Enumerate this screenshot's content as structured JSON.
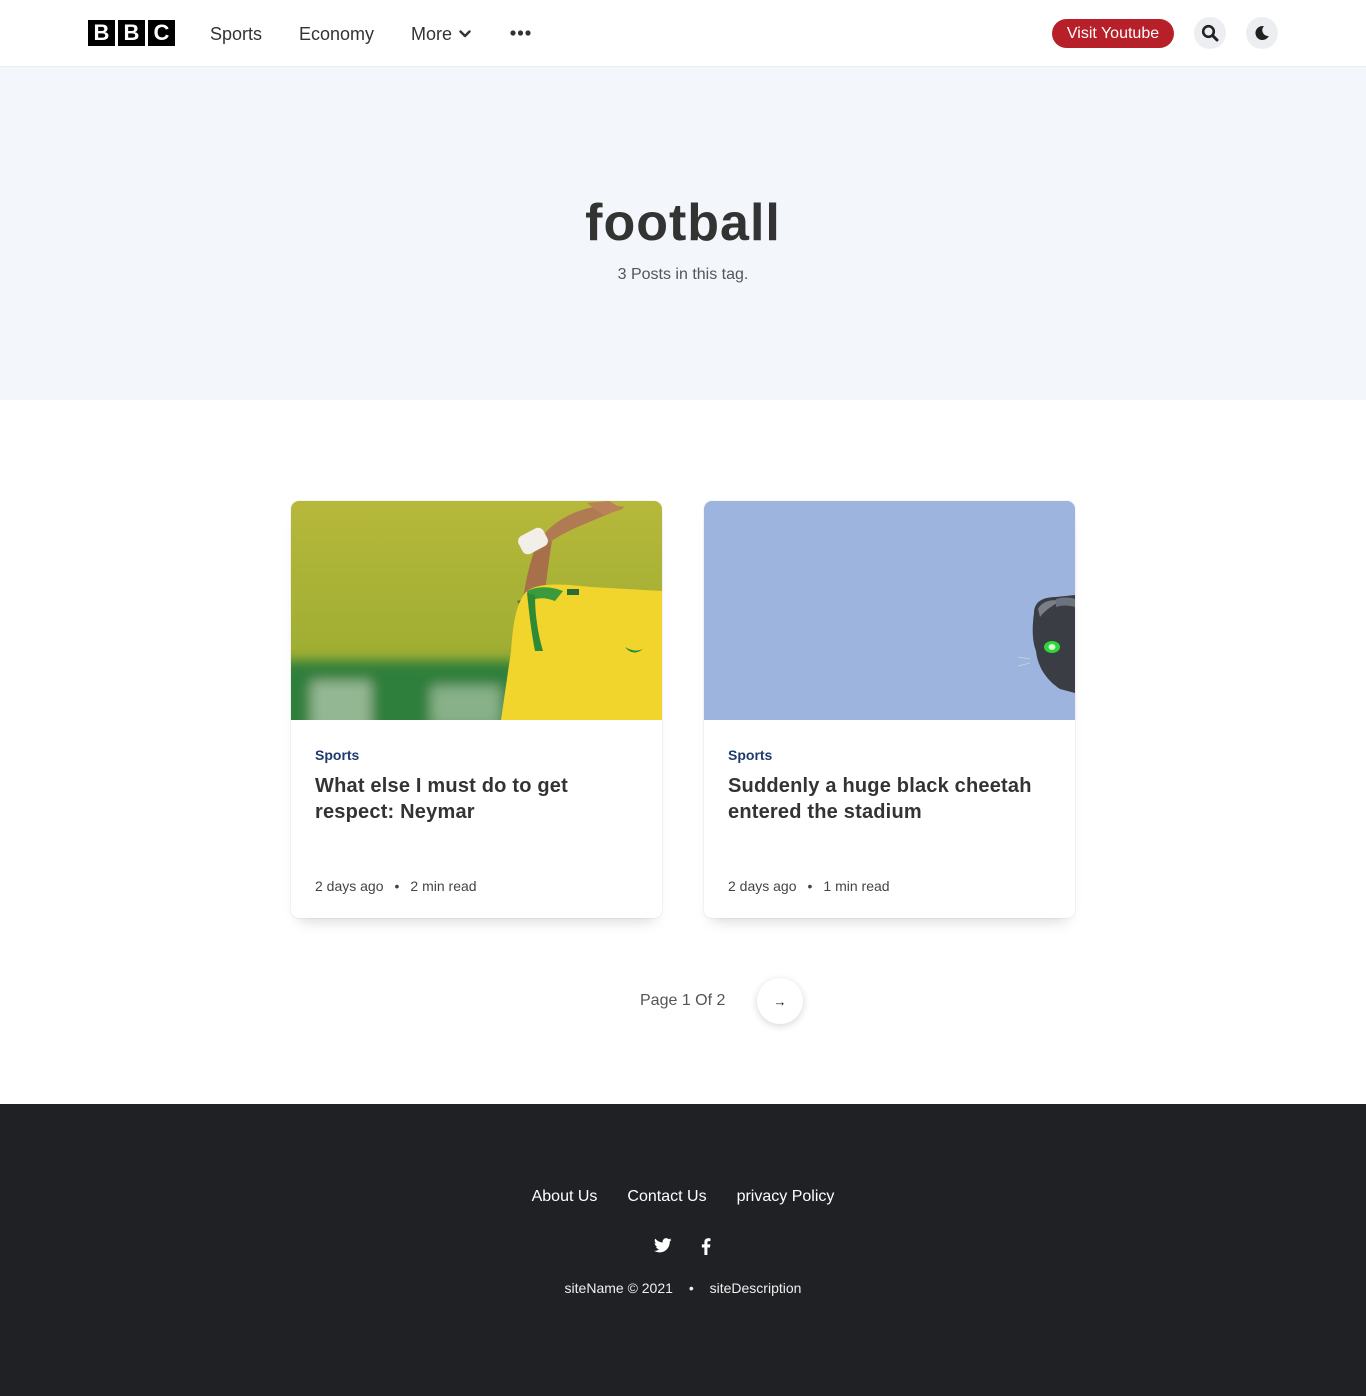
{
  "header": {
    "logo_letters": [
      "B",
      "B",
      "C"
    ],
    "nav": {
      "sports": "Sports",
      "economy": "Economy",
      "more": "More"
    },
    "youtube_button": "Visit Youtube",
    "icons": [
      "chevron-down-icon",
      "more-dots-icon",
      "search-icon",
      "moon-icon"
    ]
  },
  "hero": {
    "title": "football",
    "subtitle": "3 Posts in this tag."
  },
  "posts": [
    {
      "tag": "Sports",
      "title": "What else I must do to get respect: Neymar",
      "date": "2 days ago",
      "read_time": "2 min read"
    },
    {
      "tag": "Sports",
      "title": "Suddenly a huge black cheetah entered the stadium",
      "date": "2 days ago",
      "read_time": "1 min read"
    }
  ],
  "pagination": {
    "text": "Page 1 Of 2",
    "next_symbol": "→"
  },
  "footer": {
    "links": [
      "About Us",
      "Contact Us",
      "privacy Policy"
    ],
    "social_icons": [
      "twitter-icon",
      "facebook-icon"
    ],
    "copyright": "siteName © 2021",
    "separator": "•",
    "description": "siteDescription"
  },
  "colors": {
    "accent_red": "#b71f29",
    "tag_blue": "#1e3a6e",
    "hero_bg": "#f3f6fb",
    "footer_bg": "#202124"
  }
}
